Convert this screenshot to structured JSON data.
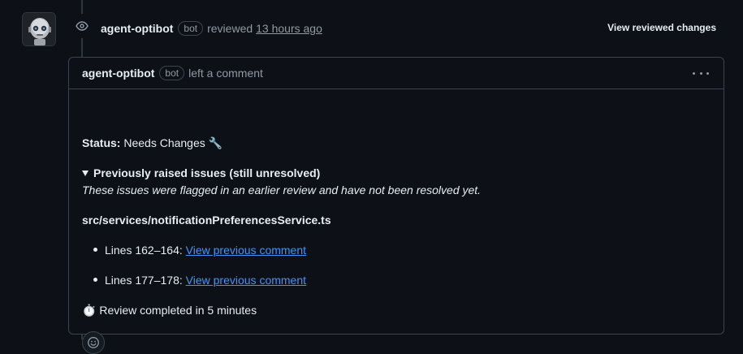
{
  "review": {
    "author": "agent-optibot",
    "bot_badge": "bot",
    "action": "reviewed",
    "time": "13 hours ago",
    "view_changes_label": "View reviewed changes"
  },
  "comment": {
    "author": "agent-optibot",
    "bot_badge": "bot",
    "action": "left a comment",
    "status_label": "Status:",
    "status_value": "Needs Changes",
    "status_emoji": "🔧",
    "details_summary": "Previously raised issues (still unresolved)",
    "details_note": "These issues were flagged in an earlier review and have not been resolved yet.",
    "file_path": "src/services/notificationPreferencesService.ts",
    "issues": [
      {
        "lines": "Lines 162–164:",
        "link": "View previous comment"
      },
      {
        "lines": "Lines 177–178:",
        "link": "View previous comment"
      }
    ],
    "completion_emoji": "⏱️",
    "completion_text": "Review completed in 5 minutes"
  },
  "icons": {
    "avatar": "robot-avatar",
    "review": "eye-icon",
    "menu": "kebab-menu-icon",
    "reaction": "smiley-icon"
  },
  "colors": {
    "background": "#0d1117",
    "border": "#3d444d",
    "text": "#e6edf3",
    "muted": "#9198a1",
    "link": "#4493f8"
  }
}
